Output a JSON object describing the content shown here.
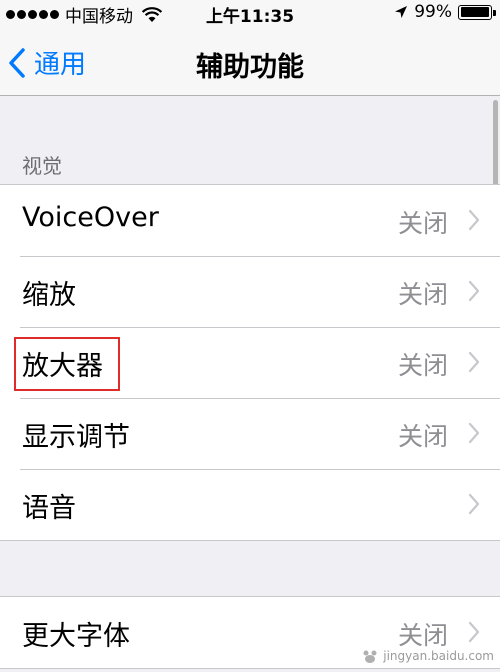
{
  "status_bar": {
    "carrier": "中国移动",
    "time": "上午11:35",
    "battery": "99%",
    "battery_level": 0.99
  },
  "nav": {
    "back_label": "通用",
    "title": "辅助功能"
  },
  "sections": {
    "vision_header": "视觉"
  },
  "vision_items": [
    {
      "label": "VoiceOver",
      "value": "关闭"
    },
    {
      "label": "缩放",
      "value": "关闭"
    },
    {
      "label": "放大器",
      "value": "关闭"
    },
    {
      "label": "显示调节",
      "value": "关闭"
    },
    {
      "label": "语音",
      "value": ""
    }
  ],
  "text_items": [
    {
      "label": "更大字体",
      "value": "关闭"
    }
  ],
  "watermark": "jingyan.baidu.com",
  "colors": {
    "accent": "#007aff",
    "highlight": "#e02b2b",
    "background": "#efeff4"
  }
}
